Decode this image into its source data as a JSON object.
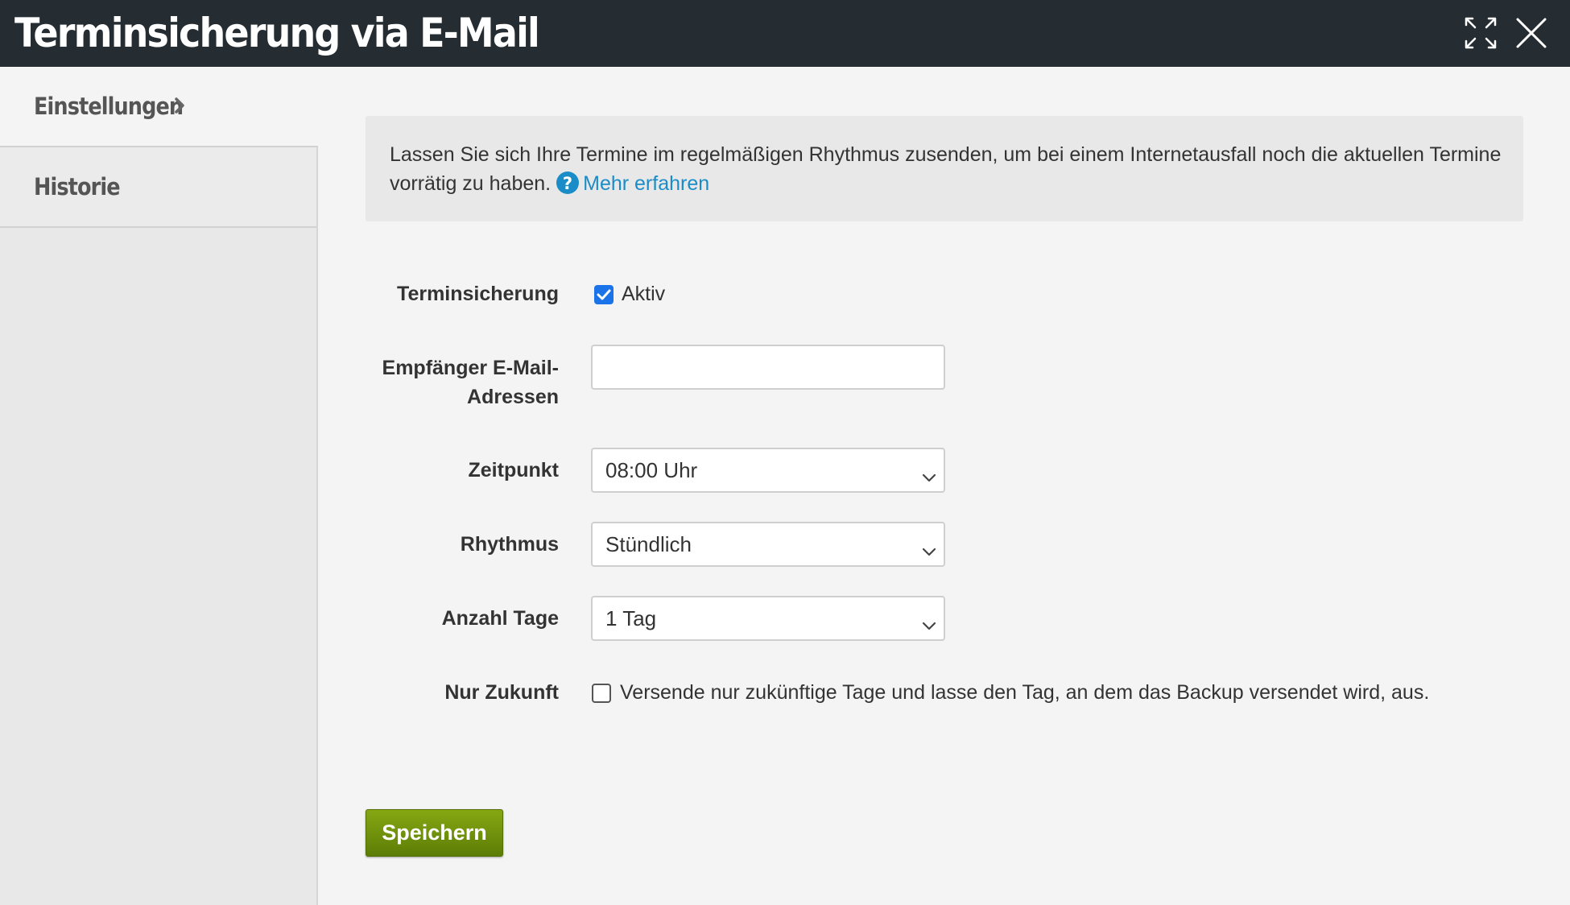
{
  "window": {
    "title": "Terminsicherung via E-Mail",
    "expand_icon": "expand-icon",
    "close_icon": "close-icon"
  },
  "sidebar": {
    "items": [
      {
        "label": "Einstellungen",
        "active": true
      },
      {
        "label": "Historie",
        "active": false
      }
    ]
  },
  "info": {
    "text": "Lassen Sie sich Ihre Termine im regelmäßigen Rhythmus zusenden, um bei einem Internetausfall noch die aktuellen Termine vorrätig zu haben.",
    "help_icon": "question-circle-icon",
    "link_label": "Mehr erfahren"
  },
  "form": {
    "terminsicherung": {
      "label": "Terminsicherung",
      "checkbox_label": "Aktiv",
      "checked": true
    },
    "empfaenger": {
      "label_line1": "Empfänger E-Mail-",
      "label_line2": "Adressen",
      "value": "",
      "placeholder": ""
    },
    "zeitpunkt": {
      "label": "Zeitpunkt",
      "value": "08:00 Uhr"
    },
    "rhythmus": {
      "label": "Rhythmus",
      "value": "Stündlich"
    },
    "anzahl_tage": {
      "label": "Anzahl Tage",
      "value": "1 Tag"
    },
    "nur_zukunft": {
      "label": "Nur Zukunft",
      "checkbox_label": "Versende nur zukünftige Tage und lasse den Tag, an dem das Backup versendet wird, aus.",
      "checked": false
    }
  },
  "actions": {
    "save_label": "Speichern"
  },
  "colors": {
    "titlebar": "#252d32",
    "link": "#1a8cc8",
    "checkbox_active": "#1a73e8",
    "save_button": "#6f900c"
  }
}
